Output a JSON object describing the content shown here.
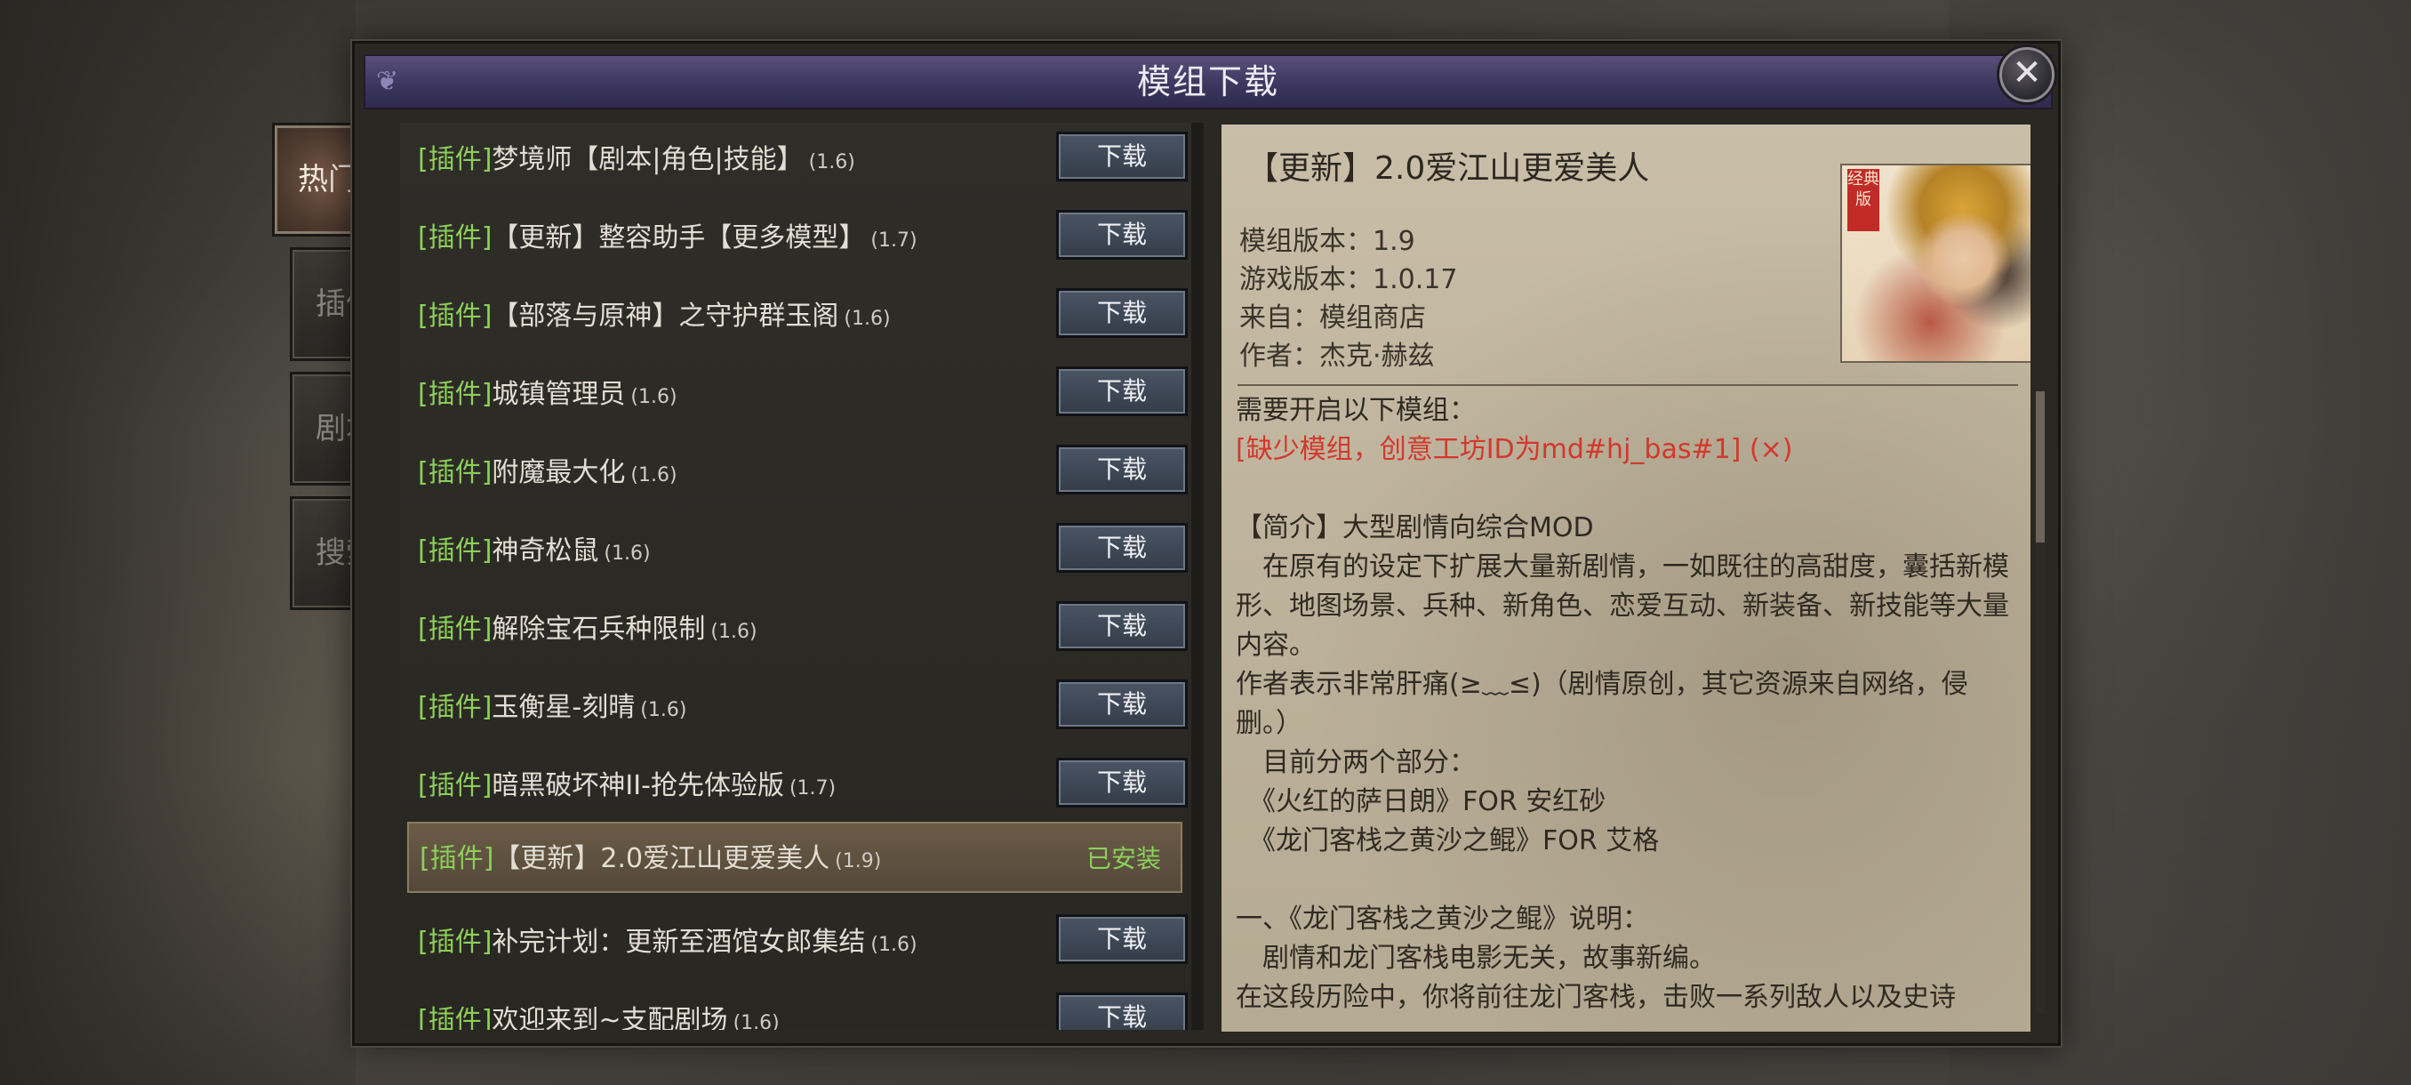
{
  "dialog": {
    "title": "模组下载",
    "close_glyph": "✕"
  },
  "tabs": [
    {
      "label": "热门",
      "active": true
    },
    {
      "label": "插件",
      "active": false
    },
    {
      "label": "剧本",
      "active": false
    },
    {
      "label": "搜索",
      "active": false
    }
  ],
  "list": {
    "items": [
      {
        "tag": "[插件]",
        "name": "梦境师【剧本|角色|技能】",
        "version": "(1.6)",
        "action": "下载"
      },
      {
        "tag": "[插件]",
        "name": "【更新】整容助手【更多模型】",
        "version": "(1.7)",
        "action": "下载"
      },
      {
        "tag": "[插件]",
        "name": "【部落与原神】之守护群玉阁",
        "version": "(1.6)",
        "action": "下载"
      },
      {
        "tag": "[插件]",
        "name": "城镇管理员",
        "version": "(1.6)",
        "action": "下载"
      },
      {
        "tag": "[插件]",
        "name": "附魔最大化",
        "version": "(1.6)",
        "action": "下载"
      },
      {
        "tag": "[插件]",
        "name": "神奇松鼠",
        "version": "(1.6)",
        "action": "下载"
      },
      {
        "tag": "[插件]",
        "name": "解除宝石兵种限制",
        "version": "(1.6)",
        "action": "下载"
      },
      {
        "tag": "[插件]",
        "name": "玉衡星-刻晴",
        "version": "(1.6)",
        "action": "下载"
      },
      {
        "tag": "[插件]",
        "name": "暗黑破坏神II-抢先体验版",
        "version": "(1.7)",
        "action": "下载"
      },
      {
        "tag": "[插件]",
        "name": "【更新】2.0爱江山更爱美人",
        "version": "(1.9)",
        "action": "已安装"
      },
      {
        "tag": "[插件]",
        "name": "补完计划：更新至酒馆女郎集结",
        "version": "(1.6)",
        "action": "下载"
      },
      {
        "tag": "[插件]",
        "name": "欢迎来到~支配剧场",
        "version": "(1.6)",
        "action": "下载"
      }
    ]
  },
  "detail": {
    "title": "【更新】2.0爱江山更爱美人",
    "thumb_seal": "经典版",
    "meta": {
      "mod_version": "模组版本：1.9",
      "game_version": "游戏版本：1.0.17",
      "source": "来自：模组商店",
      "author": "作者：杰克·赫兹"
    },
    "requires_label": "需要开启以下模组：",
    "missing_mod": "[缺少模组，创意工坊ID为md#hj_bas#1] (×)",
    "intro_title": "【简介】大型剧情向综合MOD",
    "intro_1": "　在原有的设定下扩展大量新剧情，一如既往的高甜度，囊括新模形、地图场景、兵种、新角色、恋爱互动、新装备、新技能等大量内容。",
    "intro_2": "作者表示非常肝痛(≥﹏≤)（剧情原创，其它资源来自网络，侵删。）",
    "intro_3": "　目前分两个部分：",
    "part_1": "　《火红的萨日朗》FOR 安红砂",
    "part_2": "　《龙门客栈之黄沙之鲲》FOR 艾格",
    "section_1": "一、《龙门客栈之黄沙之鲲》说明：",
    "section_1_a": "　剧情和龙门客栈电影无关，故事新编。",
    "section_1_b": "在这段历险中，你将前往龙门客栈，击败一系列敌人以及史诗"
  }
}
